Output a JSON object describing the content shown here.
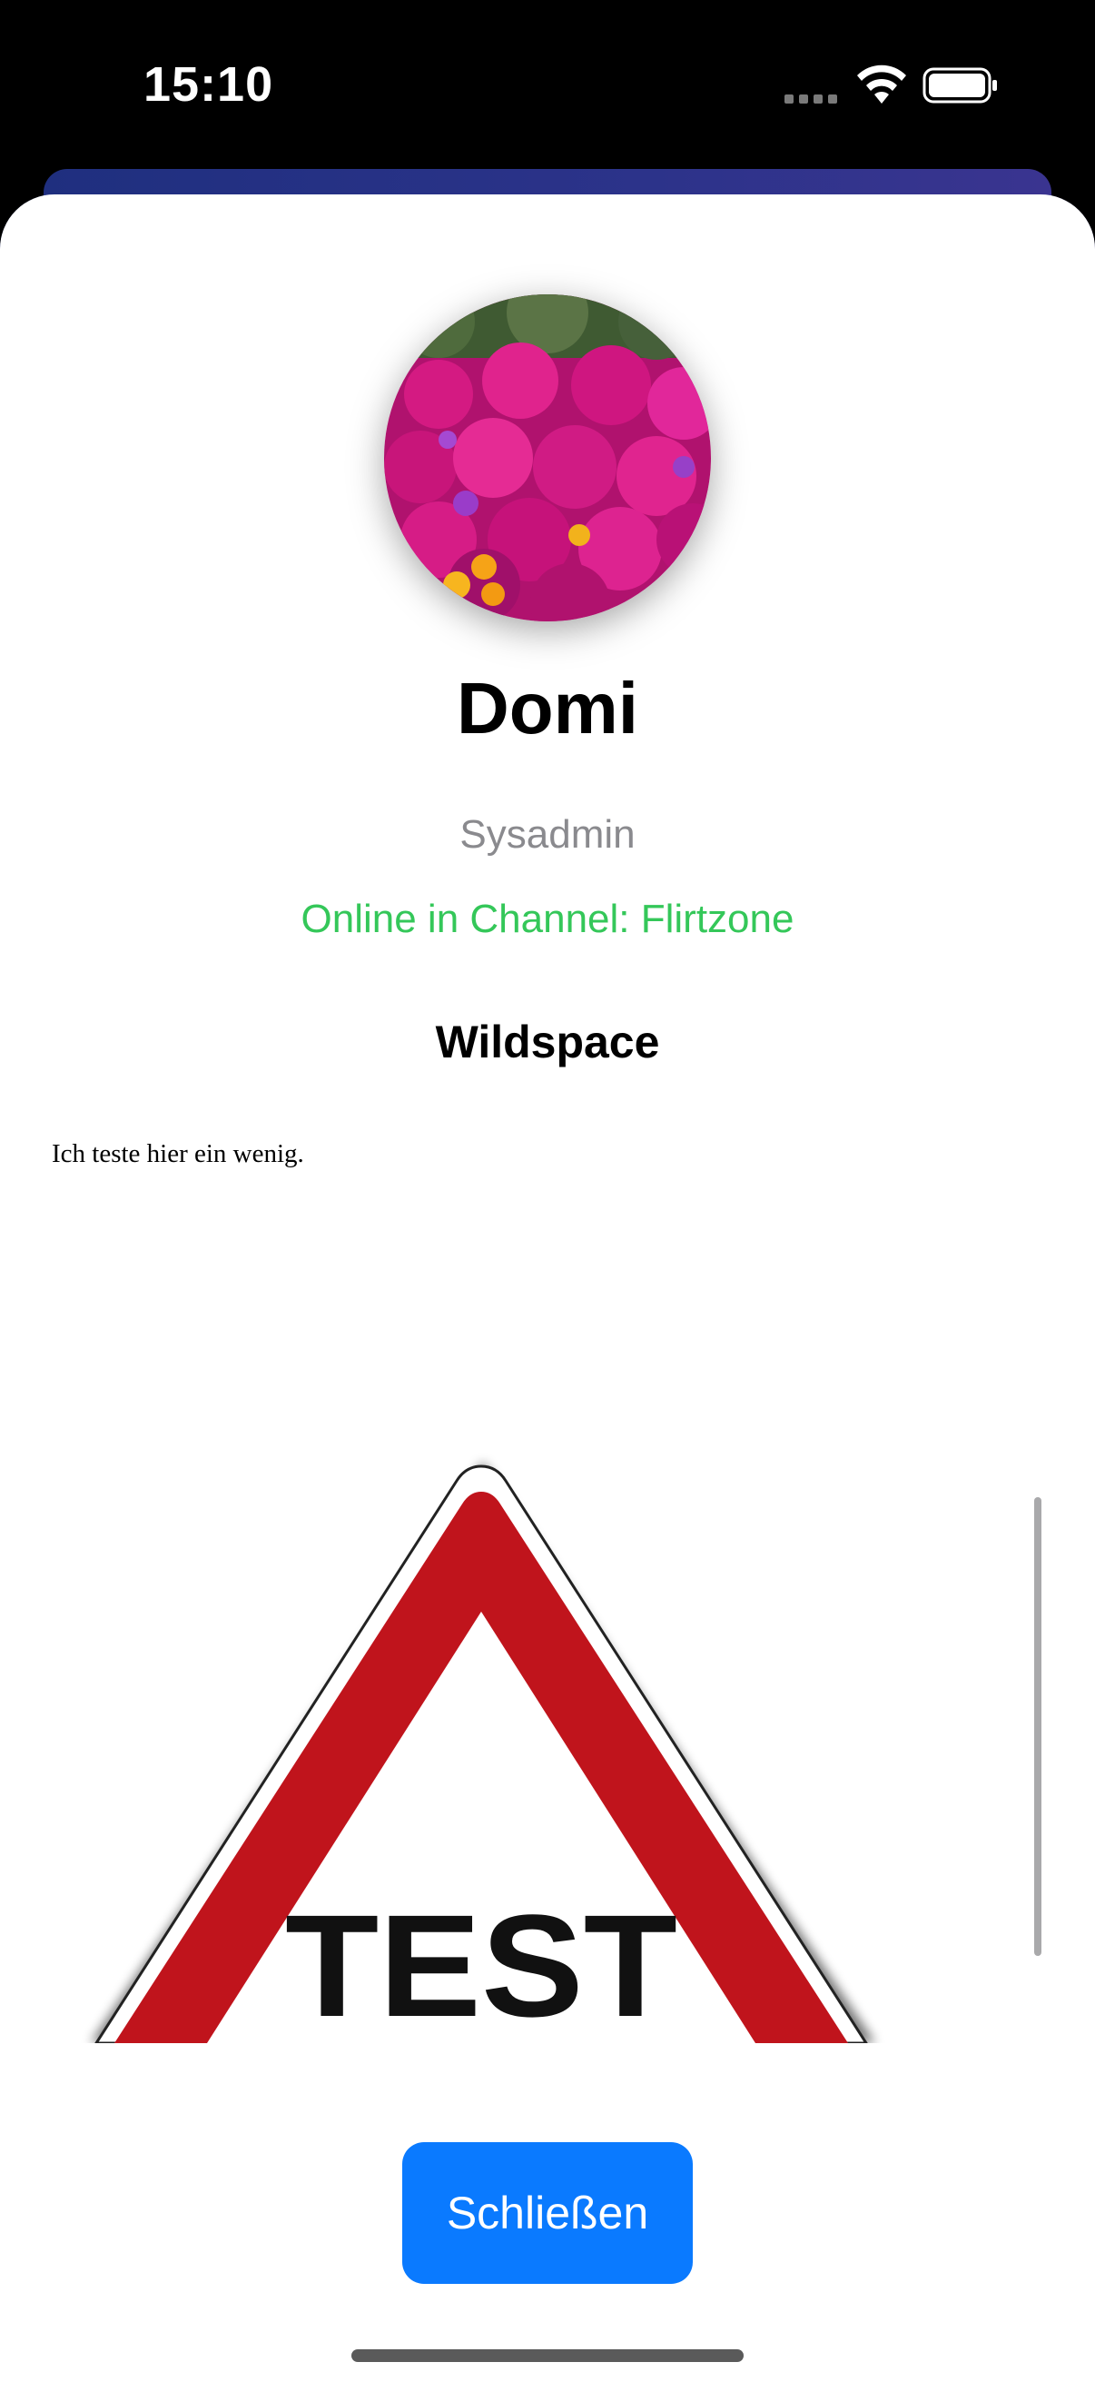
{
  "status_bar": {
    "time": "15:10",
    "signal_icon": "signal-dots-icon",
    "wifi_icon": "wifi-icon",
    "battery_icon": "battery-icon"
  },
  "profile": {
    "avatar_icon": "flower-avatar",
    "name": "Domi",
    "role": "Sysadmin",
    "online_status": "Online in Channel: Flirtzone",
    "section_title": "Wildspace",
    "bio": "Ich teste hier ein wenig.",
    "sign_text": "TEST"
  },
  "actions": {
    "close_label": "Schließen"
  },
  "colors": {
    "accent": "#0a7aff",
    "online": "#34c759",
    "muted": "#8a8a8e",
    "sign_red": "#c0141c"
  }
}
